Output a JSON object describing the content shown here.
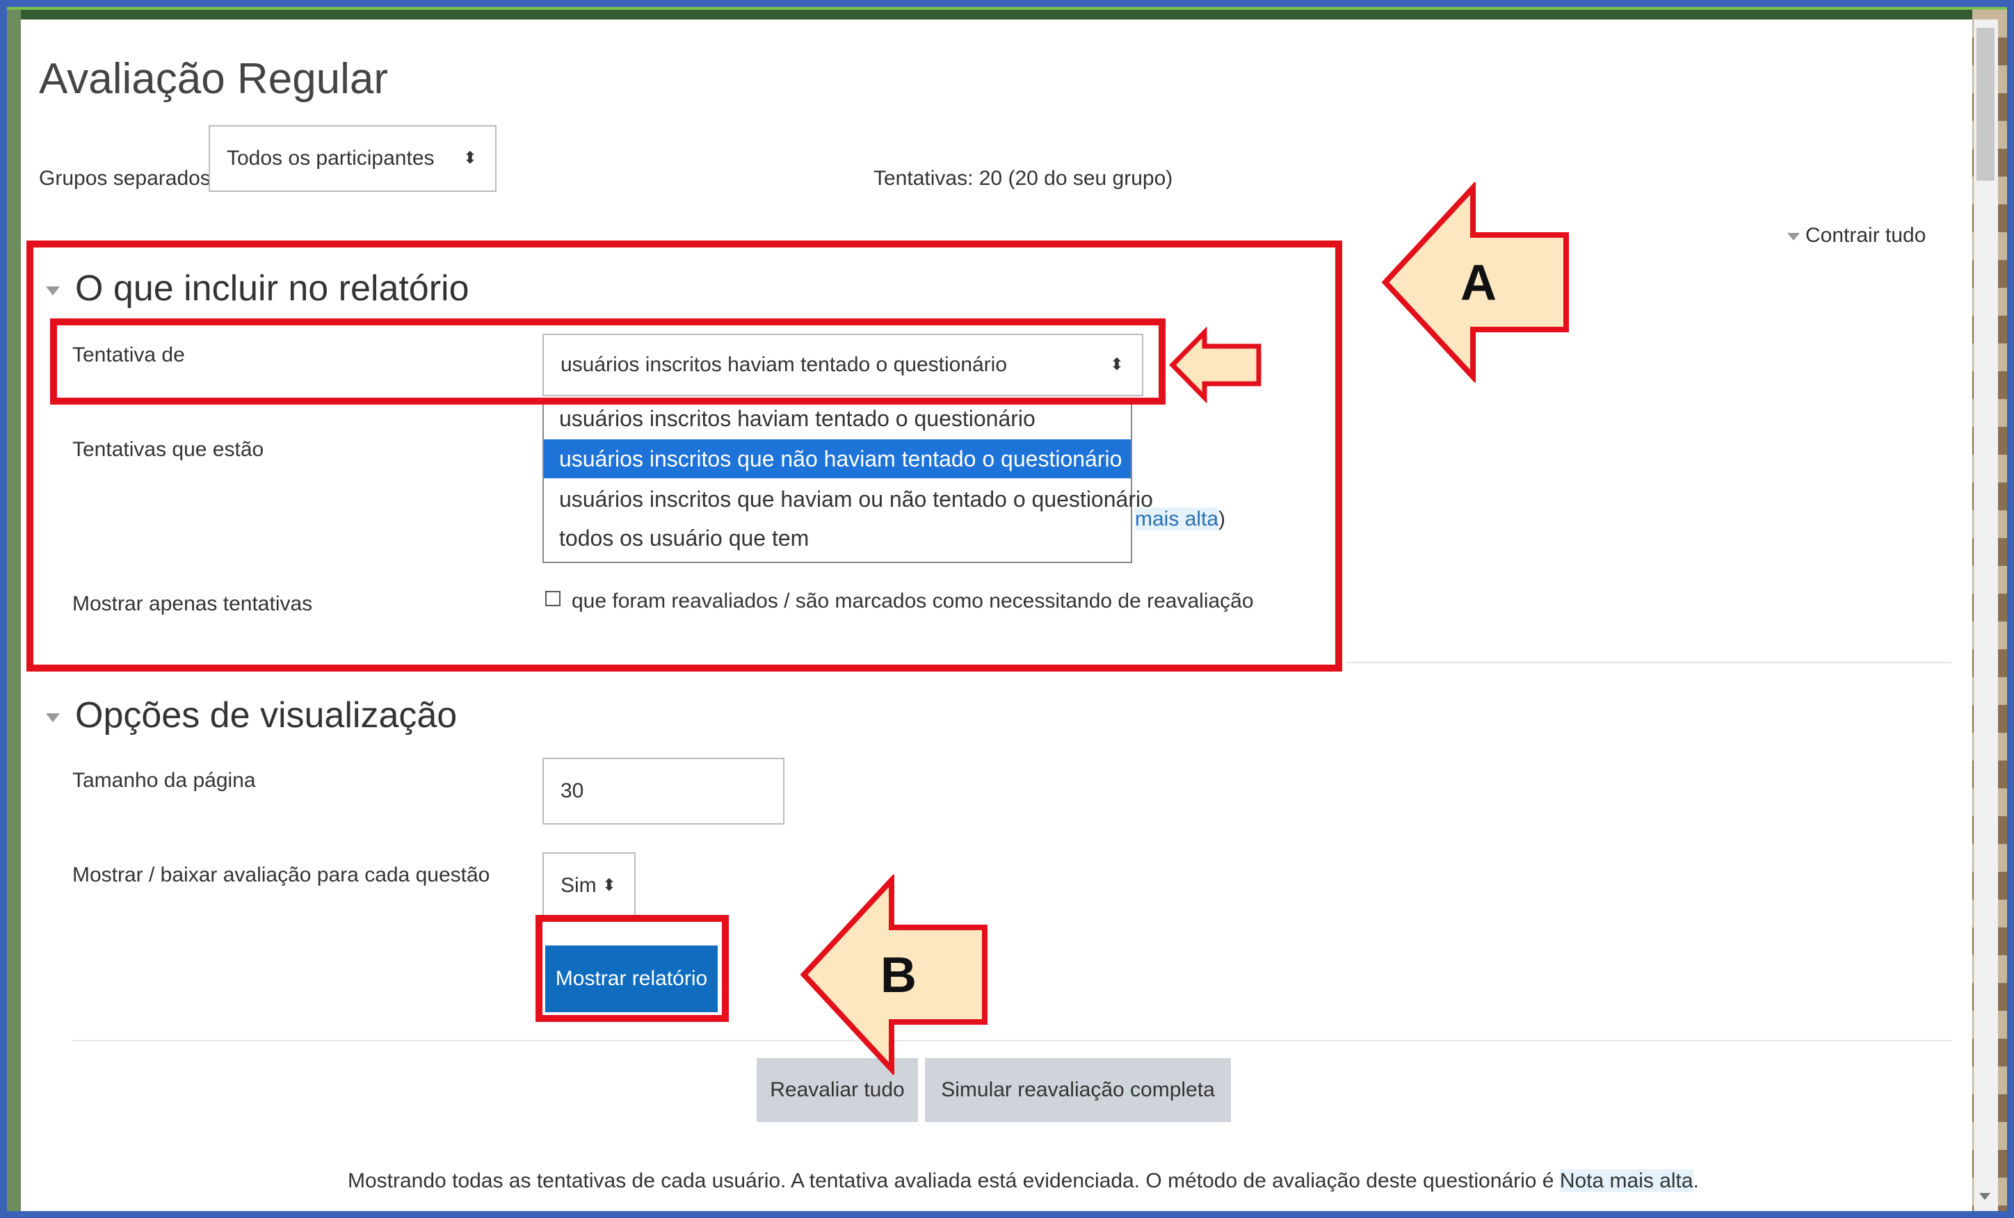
{
  "heading": "Avaliação Regular",
  "groups": {
    "label": "Grupos separados",
    "selected": "Todos os participantes"
  },
  "attempts_count": "Tentativas: 20 (20 do seu grupo)",
  "collapse_all": "Contrair tudo",
  "section_report": {
    "title": "O que incluir no relatório",
    "attempts_from_label": "Tentativa de",
    "attempts_from_selected": "usuários inscritos haviam tentado o questionário",
    "dropdown_options": [
      "usuários inscritos haviam tentado o questionário",
      "usuários inscritos que não haviam tentado o questionário",
      "usuários inscritos que haviam ou não tentado o questionário",
      "todos os usuário que tem"
    ],
    "dropdown_highlighted_index": 1,
    "attempts_state_label": "Tentativas que estão",
    "partial_text": "mais alta",
    "partial_suffix": ")",
    "show_only_label": "Mostrar apenas tentativas",
    "show_only_checkbox": "que foram reavaliados / são marcados como necessitando de reavaliação"
  },
  "section_display": {
    "title": "Opções de visualização",
    "page_size_label": "Tamanho da página",
    "page_size_value": "30",
    "show_grades_label": "Mostrar / baixar avaliação para cada questão",
    "show_grades_selected": "Sim",
    "show_report_button": "Mostrar relatório"
  },
  "actions": {
    "regrade_all": "Reavaliar tudo",
    "dry_run": "Simular reavaliação completa"
  },
  "footer": {
    "text": "Mostrando todas as tentativas de cada usuário. A tentativa avaliada está evidenciada. O método de avaliação deste questionário é ",
    "highlight": "Nota mais alta",
    "end": "."
  },
  "annotations": {
    "label_a": "A",
    "label_b": "B",
    "highlight_color": "#e3101b",
    "arrow_fill": "#fde7c1",
    "primary_button_color": "#0f6cbf",
    "dropdown_selection_color": "#1e73d8"
  }
}
